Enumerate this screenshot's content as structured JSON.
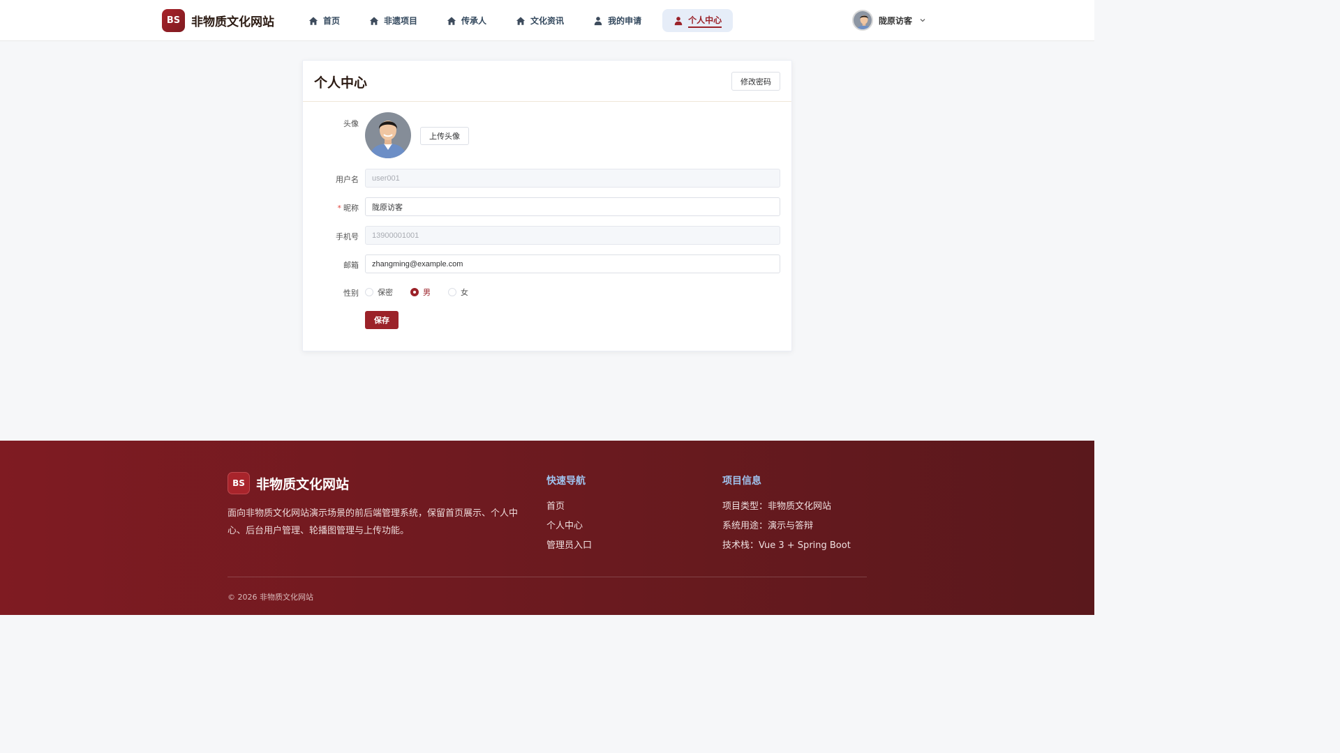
{
  "header": {
    "logo_text": "BS",
    "site_name": "非物质文化网站",
    "nav": [
      {
        "label": "首页",
        "icon": "home-icon"
      },
      {
        "label": "非遗项目",
        "icon": "home-icon"
      },
      {
        "label": "传承人",
        "icon": "home-icon"
      },
      {
        "label": "文化资讯",
        "icon": "home-icon"
      },
      {
        "label": "我的申请",
        "icon": "user-icon"
      },
      {
        "label": "个人中心",
        "icon": "user-icon",
        "active": true
      }
    ],
    "user_name": "陇原访客"
  },
  "card": {
    "title": "个人中心",
    "change_password_label": "修改密码",
    "avatar_label": "头像",
    "upload_avatar_label": "上传头像",
    "fields": {
      "username": {
        "label": "用户名",
        "value": "user001",
        "disabled": true
      },
      "nickname": {
        "label": "昵称",
        "required_mark": "*",
        "value": "陇原访客"
      },
      "phone": {
        "label": "手机号",
        "value": "13900001001",
        "disabled": true
      },
      "email": {
        "label": "邮箱",
        "value": "zhangming@example.com"
      }
    },
    "gender": {
      "label": "性别",
      "options": [
        "保密",
        "男",
        "女"
      ],
      "selected": "男"
    },
    "save_label": "保存"
  },
  "footer": {
    "logo_text": "BS",
    "site_name": "非物质文化网站",
    "description": "面向非物质文化网站演示场景的前后端管理系统，保留首页展示、个人中心、后台用户管理、轮播图管理与上传功能。",
    "quick_nav": {
      "title": "快速导航",
      "items": [
        "首页",
        "个人中心",
        "管理员入口"
      ]
    },
    "project_info": {
      "title": "项目信息",
      "items": [
        "项目类型：非物质文化网站",
        "系统用途：演示与答辩",
        "技术栈：Vue 3 + Spring Boot"
      ]
    },
    "copyright": "© 2026 非物质文化网站"
  },
  "colors": {
    "brand": "#9b2229",
    "footer_bg": "#6a1a1f",
    "nav_active_bg": "#e6edf8",
    "footer_heading": "#9fc3ee"
  }
}
